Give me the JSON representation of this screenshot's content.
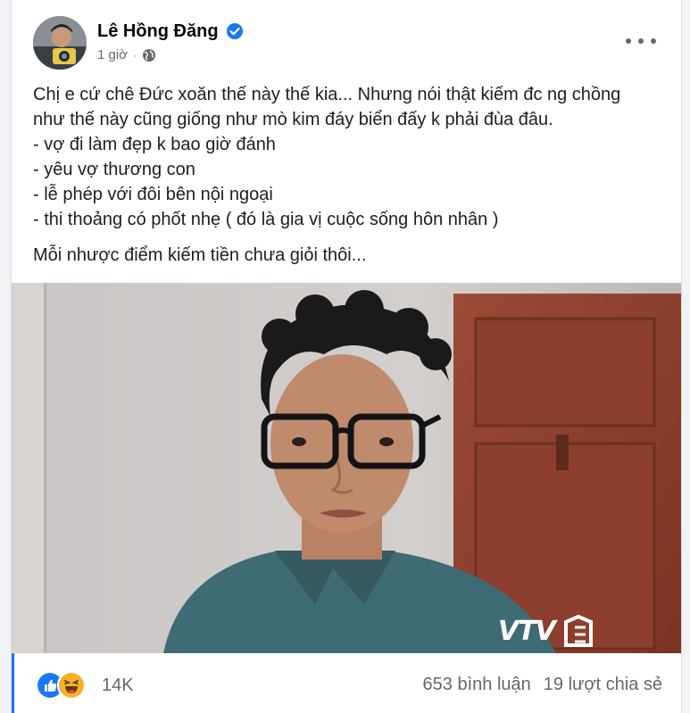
{
  "post": {
    "author": "Lê Hồng Đăng",
    "time": "1 giờ",
    "audience_icon": "globe-icon",
    "verified_icon": "verified-badge-icon",
    "text": {
      "line1": "Chị e cứ chê Đức xoăn thế này thế kia... Nhưng nói thật kiếm đc ng chồng",
      "line2": "như thế này cũng giống như mò kim đáy biển đấy k phải đùa đâu.",
      "bullets": [
        "- vợ đi làm đẹp k bao giờ đánh",
        "- yêu vợ thương con",
        "- lễ phép với đôi bên nội ngoại",
        "- thi thoảng có phốt nhẹ ( đó là gia vị cuộc sống hôn nhân )"
      ],
      "closing": "Mỗi nhược điểm kiếm tiền chưa giỏi thôi..."
    },
    "media": {
      "watermark": "VTV"
    }
  },
  "engagement": {
    "reaction_icons": [
      "like-icon",
      "haha-icon"
    ],
    "reaction_count": "14K",
    "comments": "653 bình luận",
    "shares": "19 lượt chia sẻ"
  },
  "colors": {
    "accent": "#1877f2",
    "secondary_text": "#65676b",
    "background": "#f0f2f5"
  }
}
